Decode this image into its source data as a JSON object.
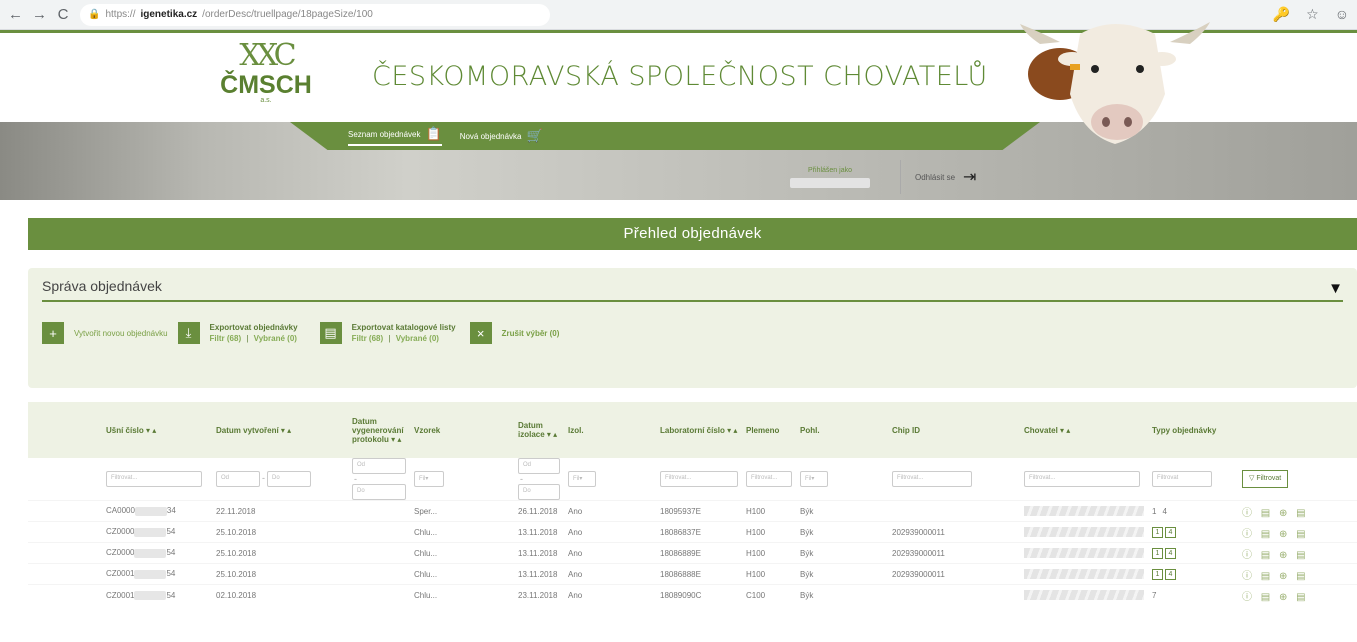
{
  "browser": {
    "back": "←",
    "forward": "→",
    "reload": "C",
    "url_prefix": "https://",
    "url_domain": "igenetika.cz",
    "url_path": "/orderDesc/truellpage/18pageSize/100",
    "key_icon": "🔑",
    "star_icon": "☆",
    "account_icon": "☺"
  },
  "header": {
    "logo_mark": "XXC",
    "logo_text": "ČMSCH",
    "logo_sub": "a.s.",
    "title": "ČESKOMORAVSKÁ SPOLEČNOST CHOVATELŮ"
  },
  "nav": {
    "items": [
      {
        "label": "Seznam objednávek",
        "icon": "📋"
      },
      {
        "label": "Nová objednávka",
        "icon": "🛒"
      }
    ],
    "logged_as": "Přihlášen jako",
    "logout": "Odhlásit se",
    "logout_icon": "⇥"
  },
  "page": {
    "header": "Přehled objednávek",
    "manage_title": "Správa objednávek",
    "toggle_icon": "▼"
  },
  "actions": {
    "create_icon": "+",
    "create": "Vytvořit novou objednávku",
    "export_icon": "⤓",
    "export_title": "Exportovat objednávky",
    "export_filter": "Filtr (68)",
    "export_selected": "Vybrané (0)",
    "catalog_icon": "▤",
    "catalog_title": "Exportovat katalogové listy",
    "catalog_filter": "Filtr (68)",
    "catalog_selected": "Vybrané (0)",
    "cancel_icon": "×",
    "cancel": "Zrušit výběr (0)",
    "sep": "|"
  },
  "table": {
    "columns": [
      "Ušní číslo ▾ ▴",
      "Datum vytvoření ▾ ▴",
      "Datum vygenerování protokolu ▾ ▴",
      "Vzorek",
      "Datum izolace ▾ ▴",
      "Izol.",
      "Laboratorní číslo ▾ ▴",
      "Plemeno",
      "Pohl.",
      "Chip ID",
      "Chovatel ▾ ▴",
      "Typy objednávky"
    ],
    "filter": {
      "text": "Filtrovat...",
      "from": "Od",
      "to": "Do",
      "select": "Filtrovat",
      "button": "Filtrovat",
      "button_icon": "▽",
      "dropdown": "Fil▾",
      "dash": "-"
    },
    "rows": [
      {
        "ear_prefix": "CA0000",
        "ear_suffix": "34",
        "created": "22.11.2018",
        "sample": "Sper...",
        "isolation": "26.11.2018",
        "isol": "Ano",
        "lab": "18095937E",
        "breed": "H100",
        "sex": "Býk",
        "chip": "",
        "types": [
          "1",
          "4"
        ],
        "boxed": false
      },
      {
        "ear_prefix": "CZ0000",
        "ear_suffix": "54",
        "created": "25.10.2018",
        "sample": "Chlu...",
        "isolation": "13.11.2018",
        "isol": "Ano",
        "lab": "18086837E",
        "breed": "H100",
        "sex": "Býk",
        "chip": "202939000011",
        "types": [
          "1",
          "4"
        ],
        "boxed": true
      },
      {
        "ear_prefix": "CZ0000",
        "ear_suffix": "54",
        "created": "25.10.2018",
        "sample": "Chlu...",
        "isolation": "13.11.2018",
        "isol": "Ano",
        "lab": "18086889E",
        "breed": "H100",
        "sex": "Býk",
        "chip": "202939000011",
        "types": [
          "1",
          "4"
        ],
        "boxed": true
      },
      {
        "ear_prefix": "CZ0001",
        "ear_suffix": "54",
        "created": "25.10.2018",
        "sample": "Chlu...",
        "isolation": "13.11.2018",
        "isol": "Ano",
        "lab": "18086888E",
        "breed": "H100",
        "sex": "Býk",
        "chip": "202939000011",
        "types": [
          "1",
          "4"
        ],
        "boxed": true
      },
      {
        "ear_prefix": "CZ0001",
        "ear_suffix": "54",
        "created": "02.10.2018",
        "sample": "Chlu...",
        "isolation": "23.11.2018",
        "isol": "Ano",
        "lab": "18089090C",
        "breed": "C100",
        "sex": "Býk",
        "chip": "",
        "types": [
          "7"
        ],
        "boxed": false
      }
    ],
    "row_icons": "ⓘ ▤ ⊕ ▤"
  },
  "colors": {
    "brand": "#6a8f3f",
    "panel_bg": "#eef2e4"
  }
}
